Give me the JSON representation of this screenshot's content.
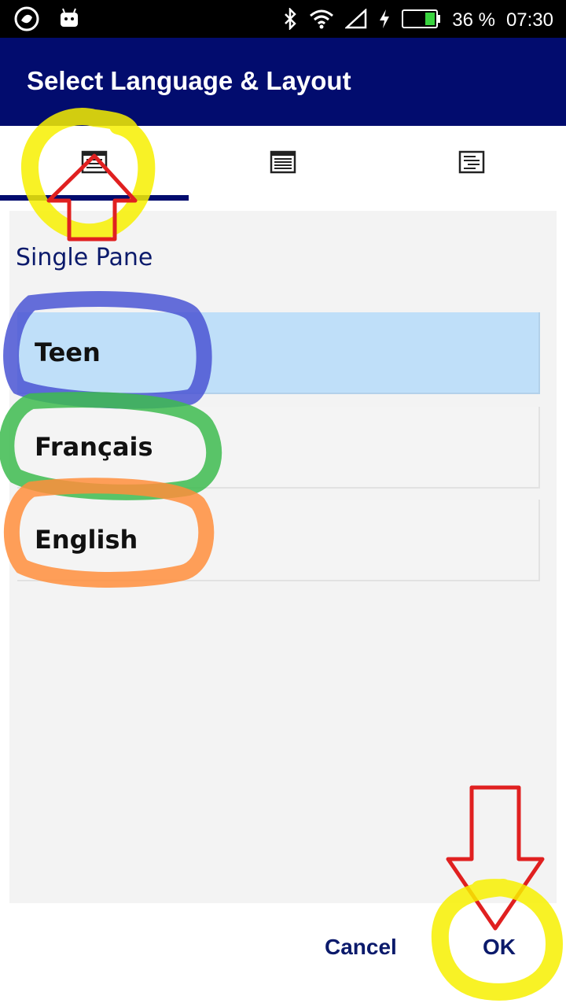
{
  "status_bar": {
    "battery_percent": "36 %",
    "time": "07:30",
    "icons": [
      "app-logo-icon",
      "android-icon",
      "bluetooth-icon",
      "wifi-icon",
      "signal-icon",
      "flash-icon",
      "battery-icon"
    ]
  },
  "app_bar": {
    "title": "Select Language & Layout"
  },
  "tabs": [
    {
      "icon": "single-pane-icon",
      "selected": true
    },
    {
      "icon": "dual-pane-icon",
      "selected": false
    },
    {
      "icon": "list-pane-icon",
      "selected": false
    }
  ],
  "pane": {
    "title": "Single Pane",
    "languages": [
      {
        "label": "Teen",
        "selected": true
      },
      {
        "label": "Français",
        "selected": false
      },
      {
        "label": "English",
        "selected": false
      }
    ]
  },
  "buttons": {
    "cancel": "Cancel",
    "ok": "OK"
  },
  "colors": {
    "app_bar": "#020c6e",
    "selected_row": "#bfdff9",
    "annotation_yellow": "#f7f000",
    "annotation_red": "#e02020",
    "annotation_blue": "#4a55d4",
    "annotation_green": "#3dbb4f",
    "annotation_orange": "#ff8e3c"
  }
}
